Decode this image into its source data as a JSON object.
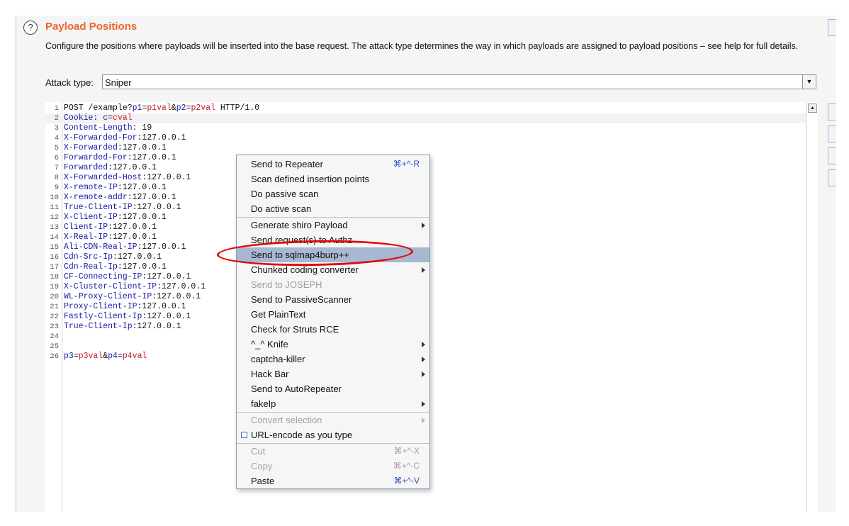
{
  "header": {
    "help_icon": "?",
    "title": "Payload Positions",
    "description": "Configure the positions where payloads will be inserted into the base request. The attack type determines the way in which payloads are assigned to payload positions – see help for full details."
  },
  "attack_type": {
    "label": "Attack type:",
    "value": "Sniper"
  },
  "editor": {
    "lines": [
      {
        "n": "1",
        "parts": [
          [
            "t",
            "POST /example?"
          ],
          [
            "k",
            "p1"
          ],
          [
            "t",
            "="
          ],
          [
            "v",
            "p1val"
          ],
          [
            "t",
            "&"
          ],
          [
            "k",
            "p2"
          ],
          [
            "t",
            "="
          ],
          [
            "v",
            "p2val"
          ],
          [
            "t",
            " HTTP/1.0"
          ]
        ]
      },
      {
        "n": "2",
        "parts": [
          [
            "k",
            "Cookie"
          ],
          [
            "t",
            ": "
          ],
          [
            "k",
            "c"
          ],
          [
            "t",
            "="
          ],
          [
            "v",
            "cval"
          ]
        ]
      },
      {
        "n": "3",
        "parts": [
          [
            "k",
            "Content-Length"
          ],
          [
            "t",
            ": 19"
          ]
        ]
      },
      {
        "n": "4",
        "parts": [
          [
            "k",
            "X-Forwarded-For"
          ],
          [
            "t",
            ":127.0.0.1"
          ]
        ]
      },
      {
        "n": "5",
        "parts": [
          [
            "k",
            "X-Forwarded"
          ],
          [
            "t",
            ":127.0.0.1"
          ]
        ]
      },
      {
        "n": "6",
        "parts": [
          [
            "k",
            "Forwarded-For"
          ],
          [
            "t",
            ":127.0.0.1"
          ]
        ]
      },
      {
        "n": "7",
        "parts": [
          [
            "k",
            "Forwarded"
          ],
          [
            "t",
            ":127.0.0.1"
          ]
        ]
      },
      {
        "n": "8",
        "parts": [
          [
            "k",
            "X-Forwarded-Host"
          ],
          [
            "t",
            ":127.0.0.1"
          ]
        ]
      },
      {
        "n": "9",
        "parts": [
          [
            "k",
            "X-remote-IP"
          ],
          [
            "t",
            ":127.0.0.1"
          ]
        ]
      },
      {
        "n": "10",
        "parts": [
          [
            "k",
            "X-remote-addr"
          ],
          [
            "t",
            ":127.0.0.1"
          ]
        ]
      },
      {
        "n": "11",
        "parts": [
          [
            "k",
            "True-Client-IP"
          ],
          [
            "t",
            ":127.0.0.1"
          ]
        ]
      },
      {
        "n": "12",
        "parts": [
          [
            "k",
            "X-Client-IP"
          ],
          [
            "t",
            ":127.0.0.1"
          ]
        ]
      },
      {
        "n": "13",
        "parts": [
          [
            "k",
            "Client-IP"
          ],
          [
            "t",
            ":127.0.0.1"
          ]
        ]
      },
      {
        "n": "14",
        "parts": [
          [
            "k",
            "X-Real-IP"
          ],
          [
            "t",
            ":127.0.0.1"
          ]
        ]
      },
      {
        "n": "15",
        "parts": [
          [
            "k",
            "Ali-CDN-Real-IP"
          ],
          [
            "t",
            ":127.0.0.1"
          ]
        ]
      },
      {
        "n": "16",
        "parts": [
          [
            "k",
            "Cdn-Src-Ip"
          ],
          [
            "t",
            ":127.0.0.1"
          ]
        ]
      },
      {
        "n": "17",
        "parts": [
          [
            "k",
            "Cdn-Real-Ip"
          ],
          [
            "t",
            ":127.0.0.1"
          ]
        ]
      },
      {
        "n": "18",
        "parts": [
          [
            "k",
            "CF-Connecting-IP"
          ],
          [
            "t",
            ":127.0.0.1"
          ]
        ]
      },
      {
        "n": "19",
        "parts": [
          [
            "k",
            "X-Cluster-Client-IP"
          ],
          [
            "t",
            ":127.0.0.1"
          ]
        ]
      },
      {
        "n": "20",
        "parts": [
          [
            "k",
            "WL-Proxy-Client-IP"
          ],
          [
            "t",
            ":127.0.0.1"
          ]
        ]
      },
      {
        "n": "21",
        "parts": [
          [
            "k",
            "Proxy-Client-IP"
          ],
          [
            "t",
            ":127.0.0.1"
          ]
        ]
      },
      {
        "n": "22",
        "parts": [
          [
            "k",
            "Fastly-Client-Ip"
          ],
          [
            "t",
            ":127.0.0.1"
          ]
        ]
      },
      {
        "n": "23",
        "parts": [
          [
            "k",
            "True-Client-Ip"
          ],
          [
            "t",
            ":127.0.0.1"
          ]
        ]
      },
      {
        "n": "24",
        "parts": []
      },
      {
        "n": "25",
        "parts": []
      },
      {
        "n": "26",
        "parts": [
          [
            "k",
            "p3"
          ],
          [
            "t",
            "="
          ],
          [
            "v",
            "p3val"
          ],
          [
            "t",
            "&"
          ],
          [
            "k",
            "p4"
          ],
          [
            "t",
            "="
          ],
          [
            "v",
            "p4val"
          ]
        ]
      }
    ]
  },
  "context_menu": {
    "items": [
      {
        "label": "Send to Repeater",
        "shortcut": "⌘+^-R"
      },
      {
        "label": "Scan defined insertion points"
      },
      {
        "label": "Do passive scan"
      },
      {
        "label": "Do active scan"
      },
      {
        "label": "Generate shiro Payload",
        "submenu": true
      },
      {
        "label": "Send request(s) to Authz"
      },
      {
        "label": "Send to sqlmap4burp++",
        "selected": true
      },
      {
        "label": "Chunked coding converter",
        "submenu": true
      },
      {
        "label": "Send to JOSEPH",
        "disabled": true
      },
      {
        "label": "Send to PassiveScanner"
      },
      {
        "label": "Get PlainText"
      },
      {
        "label": "Check for Struts RCE"
      },
      {
        "label": "^_^ Knife",
        "submenu": true
      },
      {
        "label": "captcha-killer",
        "submenu": true
      },
      {
        "label": "Hack Bar",
        "submenu": true
      },
      {
        "label": "Send to AutoRepeater"
      },
      {
        "label": "fakeIp",
        "submenu": true
      },
      {
        "label": "Convert selection",
        "submenu": true,
        "disabled": true
      },
      {
        "label": "URL-encode as you type",
        "checkbox": true
      },
      {
        "label": "Cut",
        "shortcut": "⌘+^-X",
        "disabled": true
      },
      {
        "label": "Copy",
        "shortcut": "⌘+^-C",
        "disabled": true
      },
      {
        "label": "Paste",
        "shortcut": "⌘+^-V"
      }
    ]
  },
  "colors": {
    "title": "#e8672c",
    "key": "#1a1aa6",
    "value": "#c2222a",
    "selection": "#a7b8d3",
    "annotation": "#e00a0a"
  }
}
